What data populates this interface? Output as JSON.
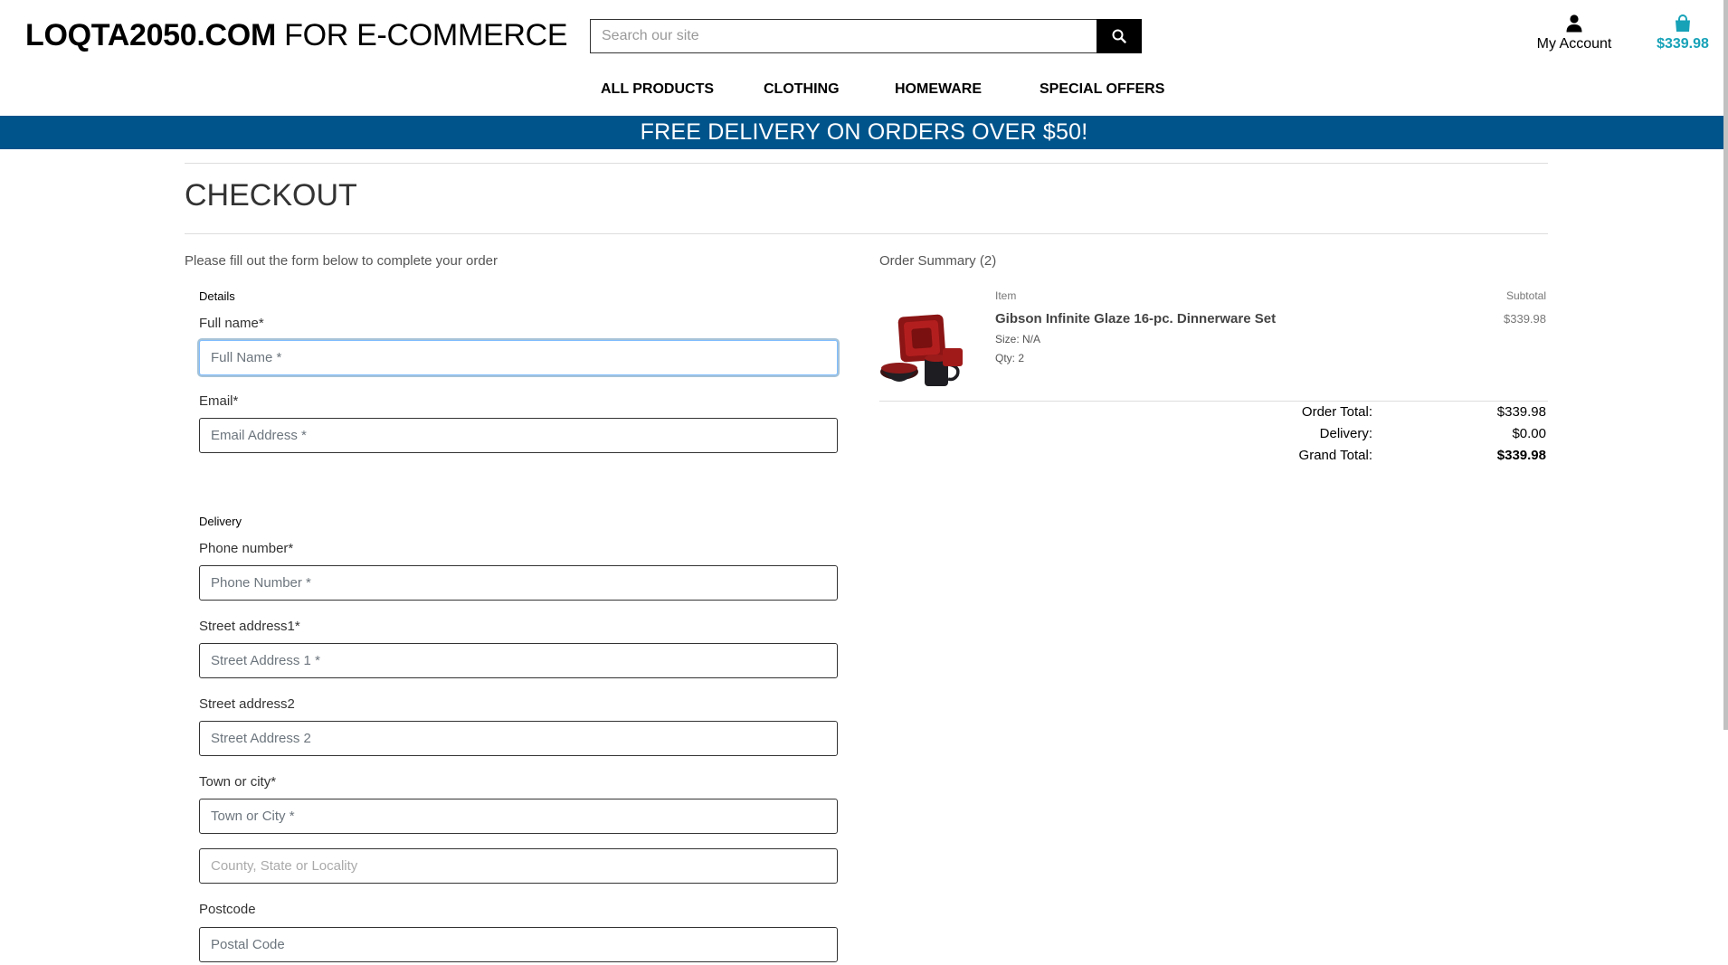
{
  "header": {
    "brand_bold": "LOQTA2050.COM",
    "brand_rest": " FOR E-COMMERCE",
    "search_placeholder": "Search our site",
    "account_label": "My Account",
    "cart_total": "$339.98"
  },
  "nav": {
    "items": [
      "ALL PRODUCTS",
      "CLOTHING",
      "HOMEWARE",
      "SPECIAL OFFERS"
    ]
  },
  "banner": {
    "text": "FREE DELIVERY ON ORDERS OVER $50!"
  },
  "checkout": {
    "title": "CHECKOUT",
    "intro": "Please fill out the form below to complete your order",
    "details_legend": "Details",
    "delivery_legend": "Delivery",
    "fields": {
      "full_name": {
        "label": "Full name*",
        "placeholder": "Full Name *"
      },
      "email": {
        "label": "Email*",
        "placeholder": "Email Address *"
      },
      "phone": {
        "label": "Phone number*",
        "placeholder": "Phone Number *"
      },
      "street1": {
        "label": "Street address1*",
        "placeholder": "Street Address 1 *"
      },
      "street2": {
        "label": "Street address2",
        "placeholder": "Street Address 2"
      },
      "town": {
        "label": "Town or city*",
        "placeholder": "Town or City *"
      },
      "county": {
        "placeholder": "County, State or Locality"
      },
      "postcode": {
        "label": "Postcode",
        "placeholder": "Postal Code"
      }
    }
  },
  "summary": {
    "title": "Order Summary (2)",
    "col_item": "Item",
    "col_subtotal": "Subtotal",
    "product": {
      "name": "Gibson Infinite Glaze 16-pc. Dinnerware Set",
      "size": "Size: N/A",
      "qty": "Qty: 2",
      "subtotal": "$339.98"
    },
    "order_total_label": "Order Total:",
    "order_total": "$339.98",
    "delivery_label": "Delivery:",
    "delivery": "$0.00",
    "grand_total_label": "Grand Total:",
    "grand_total": "$339.98"
  },
  "colors": {
    "banner": "#00548c",
    "cart_accent": "#17a2b8"
  }
}
